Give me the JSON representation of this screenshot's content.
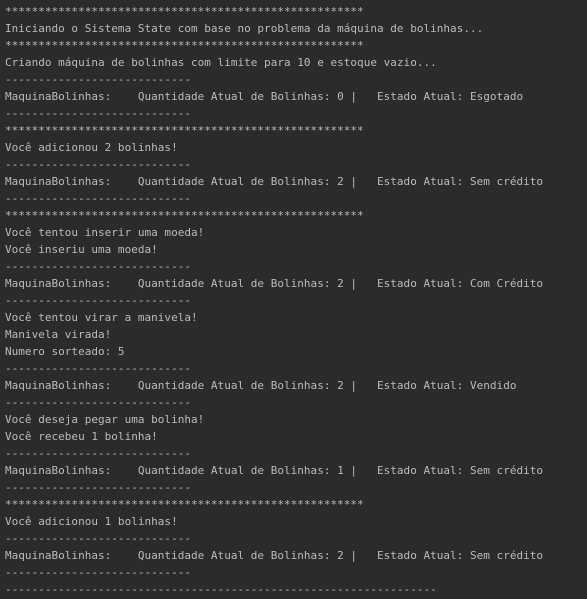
{
  "console": {
    "lines": [
      "******************************************************",
      "Iniciando o Sistema State com base no problema da máquina de bolinhas...",
      "******************************************************",
      "Criando máquina de bolinhas com limite para 10 e estoque vazio...",
      "----------------------------",
      "MaquinaBolinhas:    Quantidade Atual de Bolinhas: 0 |   Estado Atual: Esgotado",
      "----------------------------",
      "******************************************************",
      "Você adicionou 2 bolinhas!",
      "----------------------------",
      "MaquinaBolinhas:    Quantidade Atual de Bolinhas: 2 |   Estado Atual: Sem crédito",
      "----------------------------",
      "******************************************************",
      "Você tentou inserir uma moeda!",
      "Você inseriu uma moeda!",
      "----------------------------",
      "MaquinaBolinhas:    Quantidade Atual de Bolinhas: 2 |   Estado Atual: Com Crédito",
      "----------------------------",
      "Você tentou virar a manivela!",
      "Manivela virada!",
      "Numero sorteado: 5",
      "----------------------------",
      "MaquinaBolinhas:    Quantidade Atual de Bolinhas: 2 |   Estado Atual: Vendido",
      "----------------------------",
      "Você deseja pegar uma bolinha!",
      "Você recebeu 1 bolinha!",
      "----------------------------",
      "MaquinaBolinhas:    Quantidade Atual de Bolinhas: 1 |   Estado Atual: Sem crédito",
      "----------------------------",
      "******************************************************",
      "Você adicionou 1 bolinhas!",
      "----------------------------",
      "MaquinaBolinhas:    Quantidade Atual de Bolinhas: 2 |   Estado Atual: Sem crédito",
      "----------------------------",
      "-----------------------------------------------------------------"
    ]
  },
  "colors": {
    "background": "#2b2b2b",
    "text": "#bbbbbb"
  }
}
